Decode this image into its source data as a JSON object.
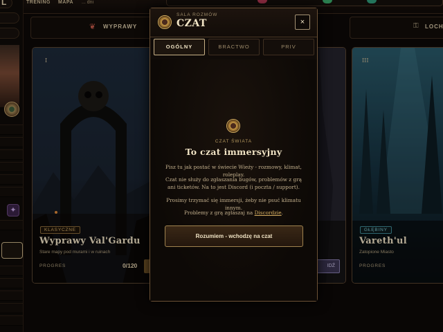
{
  "topbar": {
    "tabs": [
      "TRENING",
      "MAPA"
    ],
    "sub": "... dni"
  },
  "sidebar": {
    "top_letter": "L"
  },
  "hud": {
    "expeditions_label": "WYPRAWY",
    "right_label": "LOCHY"
  },
  "cards": [
    {
      "numeral": "I",
      "badge": "KLASYCZNE",
      "title": "Wyprawy Val'Gardu",
      "subtitle": "Stare mapy pod murami i w ruinach",
      "progress_label": "PROGRES",
      "progress_value": "0/120"
    },
    {
      "button_fragment": "IDŹ"
    },
    {
      "numeral": "III",
      "badge": "GŁĘBINY",
      "title": "Vareth'ul",
      "subtitle": "Zatopione Miasto",
      "progress_label": "PROGRES"
    }
  ],
  "modal": {
    "kicker": "SALA ROZMÓW",
    "title": "CZAT",
    "close_icon": "×",
    "tabs": [
      {
        "label": "OGÓLNY",
        "active": true
      },
      {
        "label": "BRACTWO",
        "active": false
      },
      {
        "label": "PRIV",
        "active": false
      }
    ],
    "body": {
      "kicker": "CZAT ŚWIATA",
      "heading": "To czat immersyjny",
      "p1": "Pisz tu jak postać w świecie Wieży - rozmowy, klimat, roleplay.",
      "p2": "Czat nie służy do zgłaszania bugów, problemów z grą ani ticketów. Na to jest Discord (i poczta / support).",
      "p3": "Prosimy trzymać się immersji, żeby nie psuć klimatu innym.",
      "p4_prefix": "Problemy z grą zgłaszaj na ",
      "p4_link": "Discordzie",
      "p4_suffix": ".",
      "ack_button": "Rozumiem - wchodzę na czat"
    }
  },
  "colors": {
    "accent_gold": "#c9b287",
    "link_gold": "#d9b062",
    "badge_classic": "#8a6a3a",
    "badge_depths": "#3f8a96"
  }
}
